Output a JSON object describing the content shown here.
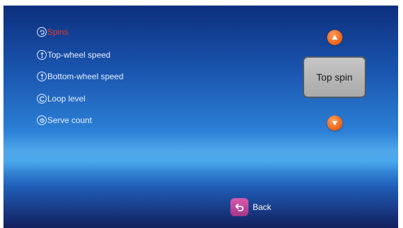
{
  "menu": {
    "items": [
      {
        "label": "Spins",
        "icon": "spin-icon",
        "active": true
      },
      {
        "label": "Top-wheel speed",
        "icon": "top-wheel-icon",
        "active": false
      },
      {
        "label": "Bottom-wheel speed",
        "icon": "bottom-wheel-icon",
        "active": false
      },
      {
        "label": "Loop level",
        "icon": "loop-icon",
        "active": false
      },
      {
        "label": "Serve count",
        "icon": "serve-count-icon",
        "active": false
      }
    ]
  },
  "selector": {
    "value": "Top spin",
    "up_icon": "arrow-up-icon",
    "down_icon": "arrow-down-icon"
  },
  "footer": {
    "back_label": "Back",
    "back_icon": "back-arrow-icon"
  },
  "colors": {
    "active_text": "#e23b2a",
    "menu_text": "#e6f0ff",
    "arrow_button": "#f06d20",
    "back_button": "#c048a0",
    "value_box": "#b8b8b8"
  }
}
